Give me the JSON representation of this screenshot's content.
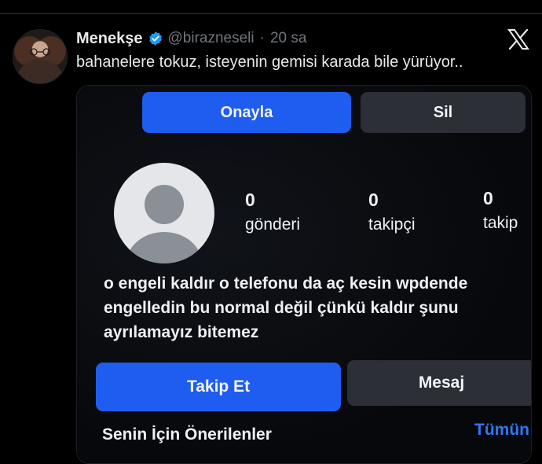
{
  "tweet": {
    "display_name": "Menekşe",
    "handle": "@birazneseli",
    "separator": "·",
    "time": "20 sa",
    "text": "bahanelere tokuz, isteyenin gemisi karada bile yürüyor..",
    "verified_icon": "verified-badge-icon",
    "close_icon": "x-logo-icon"
  },
  "media": {
    "buttons": {
      "approve": "Onayla",
      "delete": "Sil",
      "follow": "Takip Et",
      "message": "Mesaj"
    },
    "stats": [
      {
        "value": "0",
        "label": "gönderi"
      },
      {
        "value": "0",
        "label": "takipçi"
      },
      {
        "value": "0",
        "label": "takip"
      }
    ],
    "bio_lines": [
      "o engeli kaldır o telefonu da aç kesin wpdende",
      "engelledin bu normal değil çünkü kaldır şunu",
      "ayrılamayız bitemez"
    ],
    "suggestions_title": "Senin İçin Önerilenler",
    "see_all": "Tümün"
  },
  "colors": {
    "background": "#000000",
    "primary_blue": "#1f5df0",
    "secondary_button": "#2c2f36",
    "link_blue": "#2f77f3",
    "verified_blue": "#1d9bf0",
    "muted_text": "#71767b"
  }
}
